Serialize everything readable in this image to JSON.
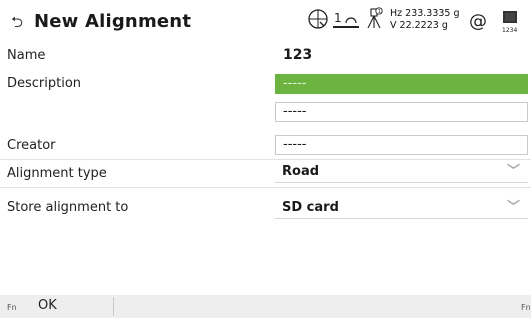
{
  "header": {
    "title": "New Alignment",
    "back_icon": "back-arrow-icon",
    "status": {
      "prism_number": "1",
      "hz": "Hz 233.3335 g",
      "v": "V  22.2223 g",
      "at_symbol": "@",
      "battery_label": "1234"
    }
  },
  "form": {
    "name": {
      "label": "Name",
      "value": "123"
    },
    "description": {
      "label": "Description",
      "value1": "-----",
      "value2": "-----"
    },
    "creator": {
      "label": "Creator",
      "value": "-----"
    },
    "alignment_type": {
      "label": "Alignment type",
      "value": "Road"
    },
    "store_to": {
      "label": "Store alignment to",
      "value": "SD card"
    }
  },
  "footer": {
    "fn_left": "Fn",
    "ok_label": "OK",
    "fn_right": "Fn"
  },
  "colors": {
    "active_field": "#6db33f",
    "footer_bg": "#eeeeee"
  }
}
